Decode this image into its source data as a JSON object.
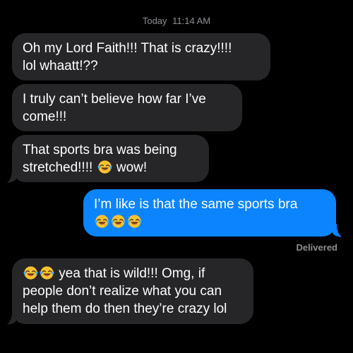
{
  "timestamp": {
    "day": "Today",
    "time": "11:14 AM"
  },
  "messages": [
    {
      "direction": "incoming",
      "line1": "Oh my Lord Faith!!! That is crazy!!!!",
      "line2": "lol whaatt!??"
    },
    {
      "direction": "incoming",
      "line1": "I truly can’t believe how far I’ve",
      "line2": "come!!!"
    },
    {
      "direction": "incoming",
      "line1": "That sports bra was being",
      "line2_before": "stretched!!!!",
      "line2_after": "wow!"
    },
    {
      "direction": "outgoing",
      "line1": "I’m like is that the same sports bra"
    },
    {
      "direction": "incoming",
      "line1_after": "yea that is wild!!! Omg, if",
      "line2": "people don’t realize what you can",
      "line3": "help them do then they’re crazy lol"
    }
  ],
  "status": {
    "delivered": "Delivered"
  },
  "emoji": {
    "name": "face-with-tears-of-joy-emoji",
    "face_color": "#f7c22f",
    "tear_color": "#4fb3f2"
  },
  "colors": {
    "background": "#000000",
    "incoming_bubble": "#262629",
    "outgoing_bubble": "#0b84fe",
    "meta_text": "#8e8e93"
  }
}
